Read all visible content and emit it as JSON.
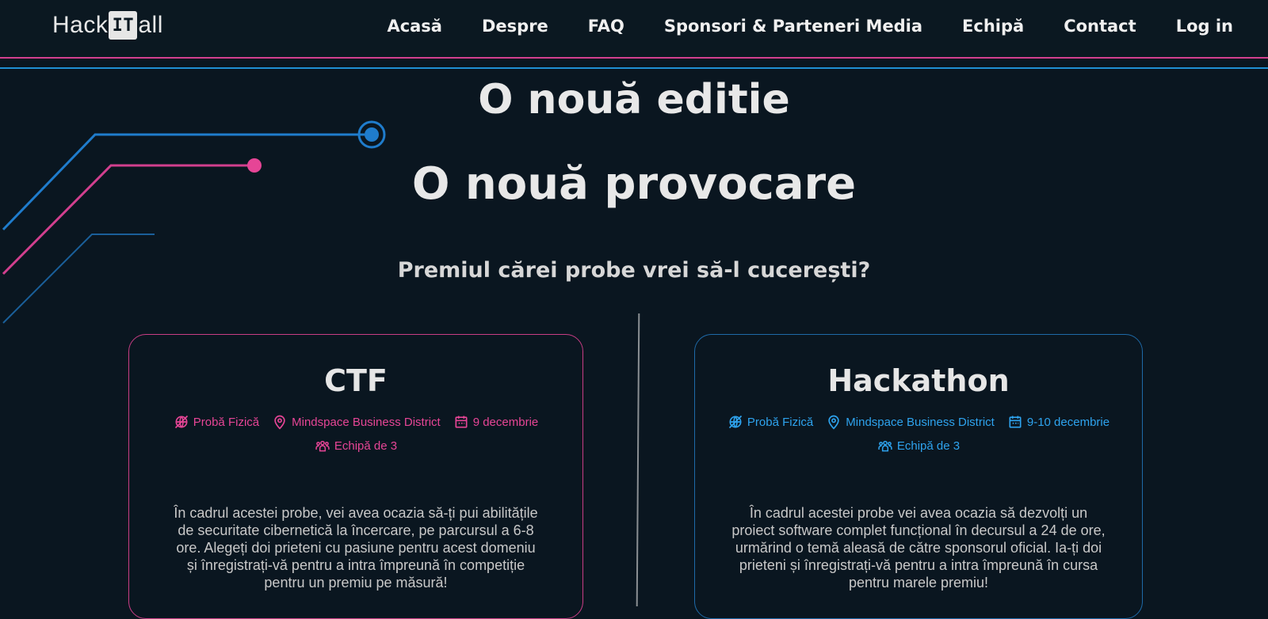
{
  "nav": {
    "logo_left": "Hack",
    "logo_box": "IT",
    "logo_right": "all",
    "links": [
      "Acasă",
      "Despre",
      "FAQ",
      "Sponsori & Parteneri Media",
      "Echipă",
      "Contact",
      "Log in"
    ]
  },
  "hero": {
    "title_1": "O nouă editie",
    "title_2": "O nouă provocare",
    "subtitle": "Premiul cărei probe vrei să-l cucerești?"
  },
  "cards": [
    {
      "title": "CTF",
      "type": "Probă Fizică",
      "location": "Mindspace Business District",
      "date": "9 decembrie",
      "team": "Echipă de 3",
      "description": "În cadrul acestei probe, vei avea ocazia să-ți pui abilitățile de securitate cibernetică la încercare, pe parcursul a 6-8 ore. Alegeți doi prieteni cu pasiune pentru acest domeniu și înregistrați-vă pentru a intra împreună în competiție pentru un premiu pe măsură!"
    },
    {
      "title": "Hackathon",
      "type": "Probă Fizică",
      "location": "Mindspace Business District",
      "date": "9-10 decembrie",
      "team": "Echipă de 3",
      "description": "În cadrul acestei probe vei avea ocazia să dezvolți un proiect software complet funcțional în decursul a 24 de ore, urmărind o temă aleasă de către sponsorul oficial. Ia-ți doi prieteni și înregistrați-vă pentru a intra împreună în cursa pentru marele premiu!"
    }
  ],
  "colors": {
    "background": "#0a1620",
    "pink": "#e64596",
    "blue": "#2ea3ee"
  }
}
